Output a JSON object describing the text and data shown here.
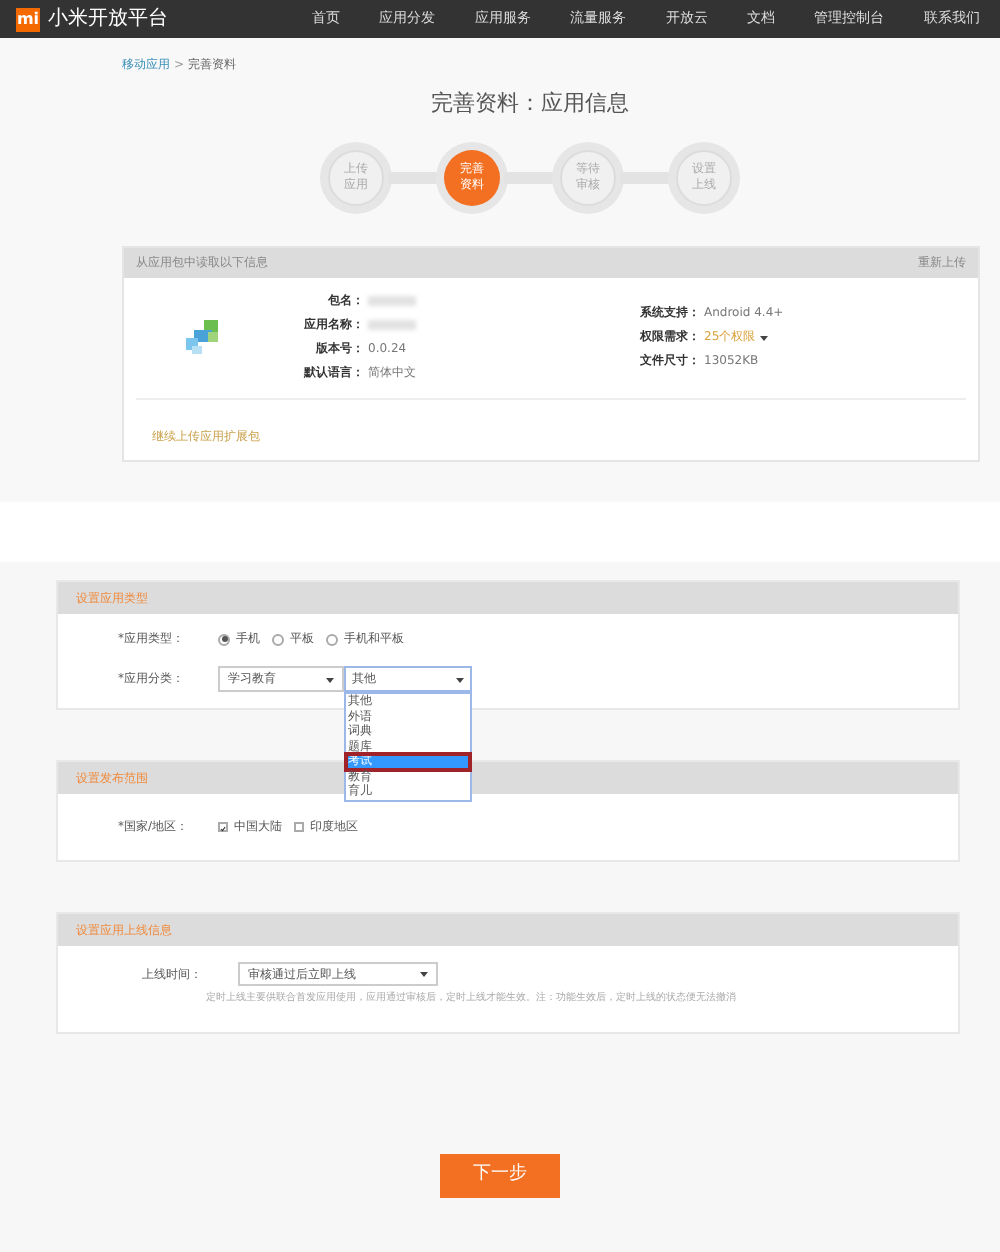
{
  "nav": {
    "logo": "mi",
    "title": "小米开放平台",
    "items": [
      "首页",
      "应用分发",
      "应用服务",
      "流量服务",
      "开放云",
      "文档",
      "管理控制台",
      "联系我们"
    ]
  },
  "breadcrumb": {
    "link": "移动应用",
    "separator": ">",
    "current": "完善资料"
  },
  "page_title": "完善资料：应用信息",
  "steps": [
    {
      "label": "上传应用",
      "selected": false
    },
    {
      "label": "完善资料",
      "selected": true
    },
    {
      "label": "等待审核",
      "selected": false
    },
    {
      "label": "设置上线",
      "selected": false
    }
  ],
  "info_card": {
    "header": "从应用包中读取以下信息",
    "action": "重新上传",
    "left": [
      {
        "label": "包名："
      },
      {
        "label": "应用名称："
      },
      {
        "label": "版本号：",
        "value": "0.0.24"
      },
      {
        "label": "默认语言：",
        "value": "简体中文"
      }
    ],
    "right": [
      {
        "label": "系统支持：",
        "value": "Android 4.4+",
        "kind": "text"
      },
      {
        "label": "权限需求：",
        "value": "25个权限",
        "kind": "dropdown"
      },
      {
        "label": "文件尺寸：",
        "value": "13052KB",
        "kind": "text"
      }
    ],
    "link": "继续上传应用扩展包"
  },
  "type_section": {
    "header": "设置应用类型",
    "type_label": "*应用类型：",
    "types": [
      {
        "label": "手机",
        "selected": true
      },
      {
        "label": "平板",
        "selected": false
      },
      {
        "label": "手机和平板",
        "selected": false
      }
    ],
    "category_label": "*应用分类：",
    "category": "学习教育",
    "subcategory": "其他",
    "options": [
      {
        "label": "其他",
        "selected": false
      },
      {
        "label": "外语",
        "selected": false
      },
      {
        "label": "词典",
        "selected": false
      },
      {
        "label": "题库",
        "selected": false
      },
      {
        "label": "考试",
        "selected": true
      },
      {
        "label": "教育",
        "selected": false
      },
      {
        "label": "育儿",
        "selected": false
      }
    ]
  },
  "region_section": {
    "header": "设置发布范围",
    "label": "*国家/地区：",
    "regions": [
      {
        "label": "中国大陆",
        "checked": true
      },
      {
        "label": "印度地区",
        "checked": false
      }
    ]
  },
  "online_section": {
    "header": "设置应用上线信息",
    "label": "上线时间：",
    "value": "审核通过后立即上线",
    "hint": "定时上线主要供联合首发应用使用，应用通过审核后，定时上线才能生效。注：功能生效后，定时上线的状态便无法撤消"
  },
  "next_button": "下一步"
}
